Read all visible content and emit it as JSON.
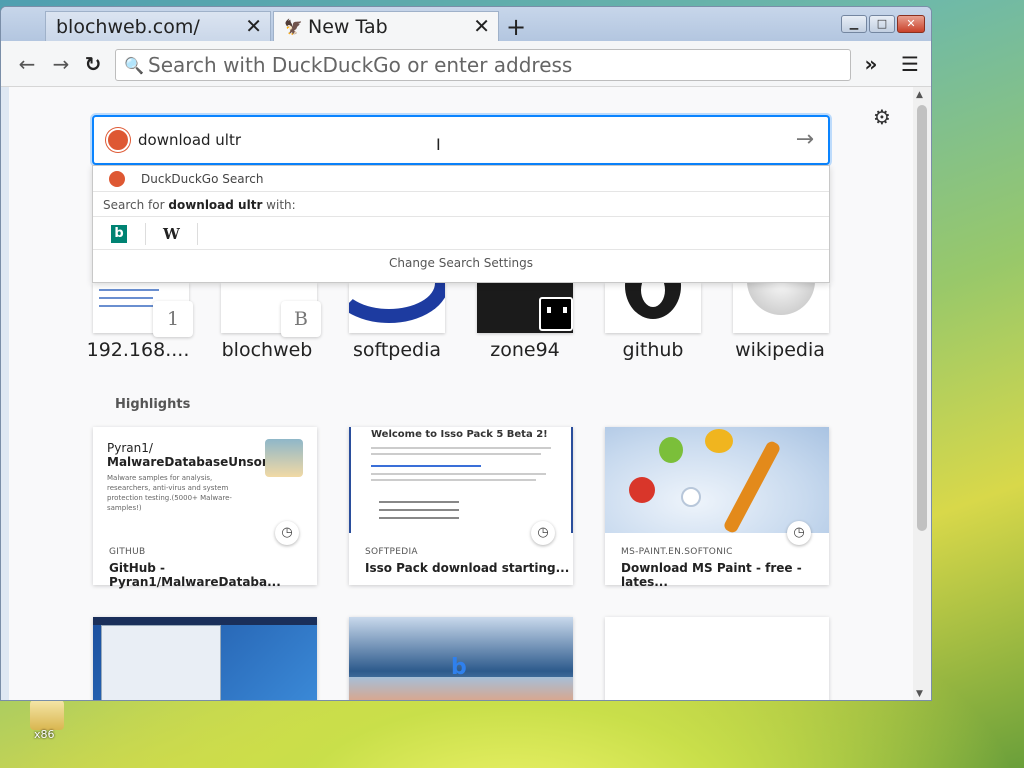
{
  "desktop": {
    "icon_label": "x86"
  },
  "tabs": [
    {
      "label": "blochweb.com/",
      "active": false
    },
    {
      "label": "New Tab",
      "active": true
    }
  ],
  "toolbar": {
    "back_icon": "arrow-left-icon",
    "forward_icon": "arrow-right-icon",
    "reload_icon": "reload-icon",
    "url_placeholder": "Search with DuckDuckGo or enter address",
    "overflow_icon": "double-chevron-icon",
    "menu_icon": "hamburger-icon"
  },
  "ntp": {
    "search_value": "download ultr",
    "dropdown": {
      "engine_row": "DuckDuckGo Search",
      "search_for_prefix": "Search for ",
      "search_for_term": "download ultr",
      "search_for_suffix": " with:",
      "engines": [
        "bing",
        "W"
      ],
      "change_settings": "Change Search Settings"
    },
    "top_sites": [
      {
        "label": "192.168....",
        "letter": "1"
      },
      {
        "label": "blochweb",
        "letter": "B"
      },
      {
        "label": "softpedia",
        "letter": ""
      },
      {
        "label": "zone94",
        "letter": ""
      },
      {
        "label": "github",
        "letter": ""
      },
      {
        "label": "wikipedia",
        "letter": ""
      }
    ],
    "highlights_title": "Highlights",
    "highlights": [
      {
        "source": "GITHUB",
        "title": "GitHub - Pyran1/MalwareDataba...",
        "thumb_heading1": "Pyran1/",
        "thumb_heading2": "MalwareDatabaseUnsor...",
        "thumb_desc": "Malware samples for analysis, researchers, anti-virus and system protection testing.(5000+ Malware-samples!)"
      },
      {
        "source": "SOFTPEDIA",
        "title": "Isso Pack download starting...",
        "thumb_heading1": "Welcome to Isso Pack 5 Beta 2!"
      },
      {
        "source": "MS-PAINT.EN.SOFTONIC",
        "title": "Download MS Paint - free - lates..."
      }
    ]
  }
}
